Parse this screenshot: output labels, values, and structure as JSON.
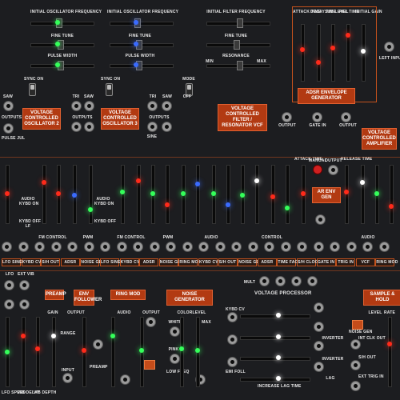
{
  "colors": {
    "accent": "#c4521c",
    "panel": "#1c1d20",
    "led_red": "#ff2a1a",
    "led_green": "#34ff5a",
    "led_blue": "#3a6bff",
    "led_white": "#ffffff"
  },
  "top": {
    "osc1_freq": "INITIAL OSCILLATOR FREQUENCY",
    "osc2_freq": "INITIAL OSCILLATOR FREQUENCY",
    "filter_freq": "INITIAL FILTER FREQUENCY",
    "attack": "ATTACK TIME",
    "decay": "DECAY TIME",
    "sustain": "SUS LEVEL",
    "release": "REL TIME",
    "initial_gain": "INITIAL GAIN",
    "fine_tune": "FINE TUNE",
    "fine_tune_2": "FINE TUNE",
    "fine_tune_3": "FINE TUNE",
    "pulse_width": "PULSE WIDTH",
    "pulse_width_2": "PULSE WIDTH",
    "resonance": "RESONANCE",
    "min": "MIN",
    "max": "MAX",
    "sync_on": "SYNC ON",
    "sync_on_2": "SYNC ON",
    "off": "OFF",
    "mode": "MODE",
    "saw": "SAW",
    "tri": "TRI",
    "outputs": "OUTPUTS",
    "pulse_jul": "PULSE JUL",
    "sine": "SINE",
    "left_input": "LEFT INPUT",
    "output": "OUTPUT",
    "gate_in": "GATE IN",
    "manual": "MANUAL",
    "attack_time": "ATTACK TIME",
    "release_time": "RELEASE TIME"
  },
  "modules": {
    "vco2": "VOLTAGE CONTROLLED OSCILLATOR 2",
    "vco3": "VOLTAGE CONTROLLED OSCILLATOR 3",
    "vcf": "VOLTAGE CONTROLLED FILTER / RESONATOR VCF",
    "adsr": "ADSR ENVELOPE GENERATOR",
    "vca": "VOLTAGE CONTROLLED AMPLIFIER",
    "ar": "AR ENV GEN"
  },
  "mid": {
    "audio": "AUDIO",
    "kybd_on": "KYBD ON",
    "kybd_off": "KYBD OFF",
    "lf": "LF",
    "fm_control": "FM CONTROL",
    "pwm": "PWM",
    "fm_control_2": "FM CONTROL",
    "pwm_2": "PWM",
    "audio_2": "AUDIO",
    "control": "CONTROL",
    "audio_3": "AUDIO"
  },
  "bottom": {
    "lfo": "LFO",
    "ext_vib": "EXT VIB",
    "preamp": "PREAMP",
    "env_follower": "ENV FOLLOWER",
    "ring_mod": "RING MOD",
    "noise_gen": "NOISE GENERATOR",
    "voltage_processor": "VOLTAGE PROCESSOR",
    "sample_hold": "SAMPLE & HOLD",
    "gain": "GAIN",
    "output": "OUTPUT",
    "range": "RANGE",
    "input": "INPUT",
    "audio": "AUDIO",
    "white": "WHITE",
    "color": "COLOR",
    "level": "LEVEL",
    "pink": "PINK",
    "low_freq": "LOW FREQ",
    "max": "MAX",
    "mult": "MULT",
    "kybd_cv": "KYBD CV",
    "inverter": "INVERTER",
    "lag": "LAG",
    "increase_lag_time": "INCREASE LAG TIME",
    "emi_follower": "EMI FOLL",
    "lfo_speed": "LFO SPEED",
    "vib_delay": "VIB DELAY",
    "vib_depth": "VIB DEPTH",
    "rate": "RATE",
    "noise_gen_jack": "NOISE GEN",
    "int_clk": "INT CLK OUT",
    "sh_out": "S/H OUT",
    "ext_trig": "EXT TRIG IN"
  },
  "strip_labels": [
    "LFO SINE",
    "KYBD CV",
    "S/H OUT",
    "ADSR",
    "NOISE GEN",
    "LFO SINE",
    "KYBD CV",
    "ADSR",
    "NOISE GEN",
    "RING MOD",
    "KYBD CV",
    "S/H OUT",
    "NOISE GEN",
    "ADSR",
    "TIME FACTOR",
    "S/H CLOCK",
    "GATE IN",
    "TRIG IN",
    "VCF",
    "RING MOD"
  ]
}
